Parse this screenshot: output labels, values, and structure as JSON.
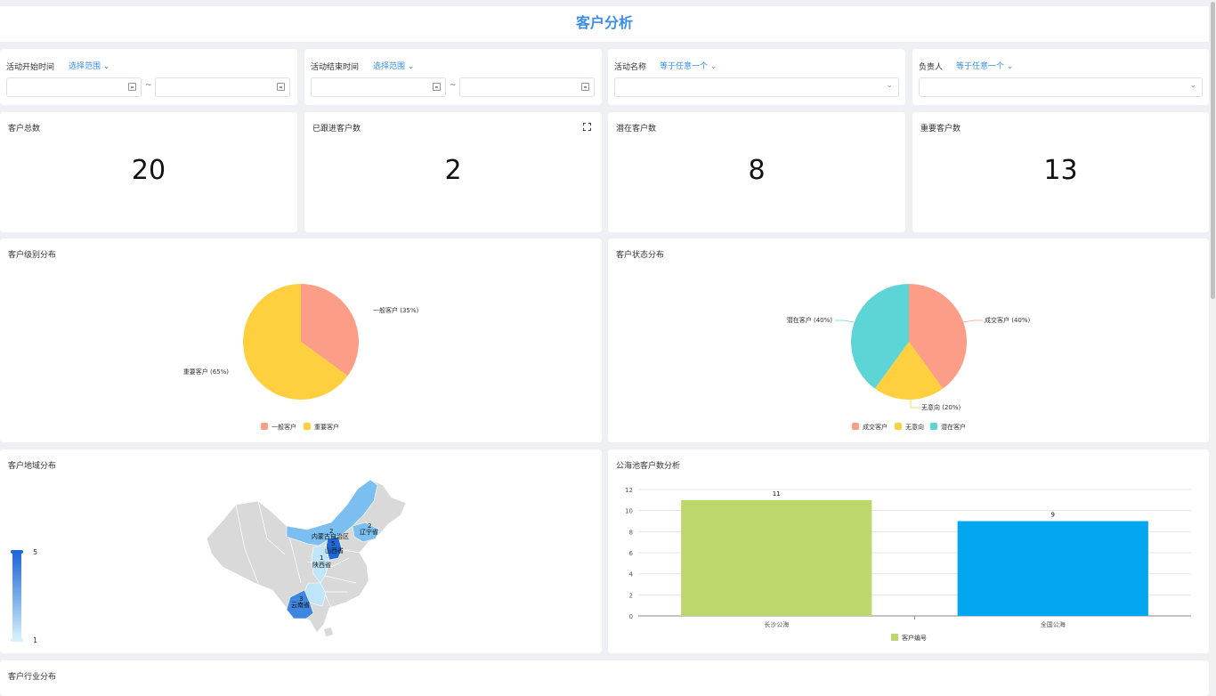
{
  "header": {
    "title": "客户分析"
  },
  "filters": [
    {
      "label": "活动开始时间",
      "op": "选择范围",
      "tilde": "~"
    },
    {
      "label": "活动结束时间",
      "op": "选择范围",
      "tilde": "~"
    },
    {
      "label": "活动名称",
      "op": "等于任意一个"
    },
    {
      "label": "负责人",
      "op": "等于任意一个"
    }
  ],
  "kpis": [
    {
      "title": "客户总数",
      "value": "20"
    },
    {
      "title": "已跟进客户数",
      "value": "2"
    },
    {
      "title": "潜在客户数",
      "value": "8"
    },
    {
      "title": "重要客户数",
      "value": "13"
    }
  ],
  "level_chart": {
    "title": "客户级别分布",
    "slices": [
      {
        "name": "一般客户",
        "label": "一般客户 (35%)",
        "pct": 35,
        "color": "#fc9d87"
      },
      {
        "name": "重要客户",
        "label": "重要客户 (65%)",
        "pct": 65,
        "color": "#fed03f"
      }
    ]
  },
  "status_chart": {
    "title": "客户状态分布",
    "slices": [
      {
        "name": "成交客户",
        "label": "成交客户 (40%)",
        "pct": 40,
        "color": "#fc9d87"
      },
      {
        "name": "无意向",
        "label": "无意向 (20%)",
        "pct": 20,
        "color": "#fed03f"
      },
      {
        "name": "潜在客户",
        "label": "潜在客户 (40%)",
        "pct": 40,
        "color": "#5dd5d6"
      }
    ]
  },
  "region_map": {
    "title": "客户地域分布",
    "scale_max": "5",
    "scale_min": "1",
    "regions": [
      {
        "name": "内蒙古自治区",
        "value": "2"
      },
      {
        "name": "辽宁省",
        "value": "2"
      },
      {
        "name": "山西省",
        "value": "5"
      },
      {
        "name": "陕西省",
        "value": "1"
      },
      {
        "name": "云南省",
        "value": "3"
      }
    ],
    "colors": {
      "low": "#bfe6f8",
      "mid": "#7bbef0",
      "high": "#1f68d6",
      "empty": "#d9d9d9"
    }
  },
  "pool_chart": {
    "title": "公海池客户数分析",
    "legend": "客户编号",
    "series_colors": [
      "#bdd76c",
      "#03a6ef"
    ]
  },
  "industry": {
    "title": "客户行业分布"
  },
  "chart_data": {
    "type": "bar",
    "categories": [
      "长沙公海",
      "全国公海"
    ],
    "values": [
      11,
      9
    ],
    "series": [
      {
        "name": "客户编号",
        "values": [
          11,
          9
        ]
      }
    ],
    "title": "公海池客户数分析",
    "ylim": [
      0,
      12
    ],
    "yticks": [
      0,
      2,
      4,
      6,
      8,
      10,
      12
    ],
    "grid": true,
    "legend": "bottom"
  }
}
